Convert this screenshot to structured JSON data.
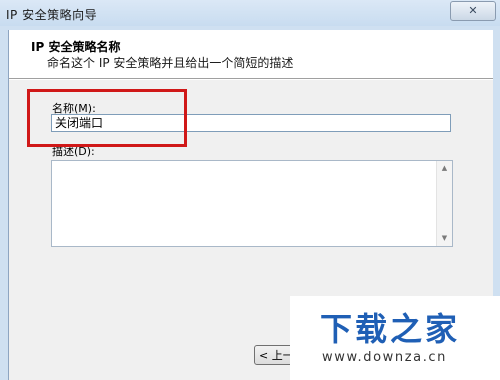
{
  "window": {
    "title": "IP 安全策略向导",
    "close_glyph": "✕"
  },
  "header": {
    "title": "IP 安全策略名称",
    "description": "命名这个 IP 安全策略并且给出一个简短的描述"
  },
  "form": {
    "name_label": "名称(M):",
    "name_value": "关闭端口",
    "description_label": "描述(D):",
    "description_value": ""
  },
  "footer": {
    "back_label": "< 上一步(B)"
  },
  "watermark": {
    "logo": "下载之家",
    "url": "www.downza.cn"
  },
  "colors": {
    "highlight": "#d01818",
    "logo": "#1f5fb5"
  },
  "icons": {
    "close": "close-icon",
    "scroll_up": "triangle-up-icon",
    "scroll_down": "triangle-down-icon"
  }
}
